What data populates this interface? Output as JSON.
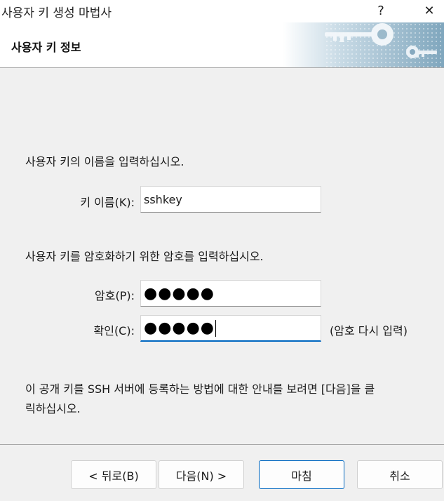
{
  "window": {
    "title": "사용자 키 생성 마법사",
    "help_label": "?",
    "close_label": "✕"
  },
  "header": {
    "title": "사용자 키 정보"
  },
  "form": {
    "name_prompt": "사용자 키의 이름을 입력하십시오.",
    "key_name_label": "키 이름(K):",
    "key_name_value": "sshkey",
    "password_prompt": "사용자 키를 암호화하기 위한 암호를 입력하십시오.",
    "password_label": "암호(P):",
    "password_mask": "●●●●●",
    "confirm_label": "확인(C):",
    "confirm_mask": "●●●●●",
    "confirm_hint": "(암호 다시 입력)",
    "info_line1": "이 공개 키를 SSH 서버에 등록하는 방법에 대한 안내를 보려면 [다음]을 클",
    "info_line2": "릭하십시오."
  },
  "buttons": {
    "back": "< 뒤로(B)",
    "next": "다음(N) >",
    "finish": "마침",
    "cancel": "취소"
  },
  "colors": {
    "accent": "#0067c0",
    "banner": "#8fb3c9"
  }
}
